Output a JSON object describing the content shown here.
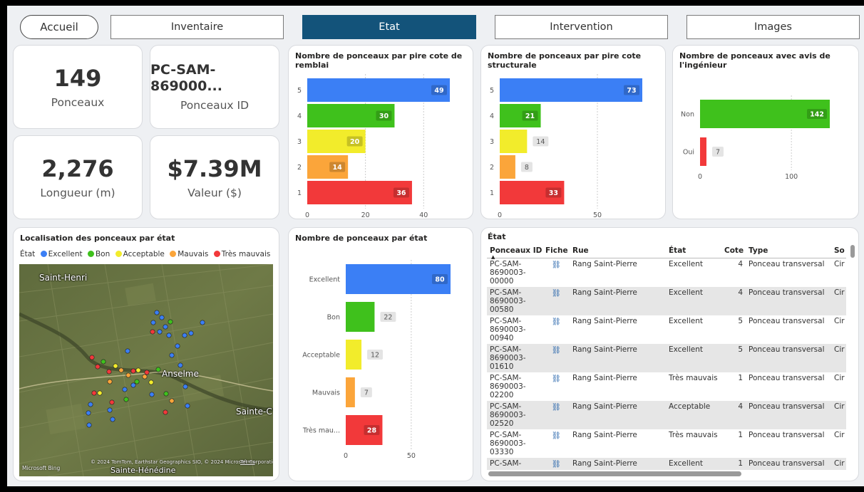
{
  "nav": {
    "home": "Accueil",
    "tabs": [
      "Inventaire",
      "Etat",
      "Intervention",
      "Images"
    ],
    "active_tab": "Etat",
    "active_color": "#13537a"
  },
  "kpis": {
    "count": {
      "value": "149",
      "label": "Ponceaux"
    },
    "id": {
      "value": "PC-SAM-869000...",
      "label": "Ponceaux ID"
    },
    "length": {
      "value": "2,276",
      "label": "Longueur (m)"
    },
    "value": {
      "value": "$7.39M",
      "label": "Valeur ($)"
    }
  },
  "colors": {
    "blue": "#3b7ff5",
    "green": "#3fc11c",
    "yellow": "#f2ec2b",
    "orange": "#fba53a",
    "red": "#f2393a",
    "nav_active": "#13537a"
  },
  "chart_data": [
    {
      "type": "bar",
      "title": "Nombre de ponceaux par pire cote de remblai",
      "categories": [
        "5",
        "4",
        "3",
        "2",
        "1"
      ],
      "values": [
        49,
        30,
        20,
        14,
        36
      ],
      "colors": [
        "#3b7ff5",
        "#3fc11c",
        "#f2ec2b",
        "#fba53a",
        "#f2393a"
      ],
      "xticks": [
        0,
        20,
        40
      ],
      "xlim": [
        0,
        49
      ],
      "grid": "vertical"
    },
    {
      "type": "bar",
      "title": "Nombre de ponceaux par pire cote structurale",
      "categories": [
        "5",
        "4",
        "3",
        "2",
        "1"
      ],
      "values": [
        73,
        21,
        14,
        8,
        33
      ],
      "colors": [
        "#3b7ff5",
        "#3fc11c",
        "#f2ec2b",
        "#fba53a",
        "#f2393a"
      ],
      "xticks": [
        0,
        50
      ],
      "xlim": [
        0,
        73
      ],
      "grid": "vertical"
    },
    {
      "type": "bar",
      "title": "Nombre de ponceaux avec avis de l'ingénieur",
      "categories": [
        "Non",
        "Oui"
      ],
      "values": [
        142,
        7
      ],
      "colors": [
        "#3fc11c",
        "#f2393a"
      ],
      "xticks": [
        0,
        100
      ],
      "xlim": [
        0,
        142
      ],
      "grid": "vertical"
    },
    {
      "type": "bar",
      "title": "Nombre de ponceaux par état",
      "categories": [
        "Excellent",
        "Bon",
        "Acceptable",
        "Mauvais",
        "Très mau..."
      ],
      "values": [
        80,
        22,
        12,
        7,
        28
      ],
      "colors": [
        "#3b7ff5",
        "#3fc11c",
        "#f2ec2b",
        "#fba53a",
        "#f2393a"
      ],
      "xticks": [
        0,
        50
      ],
      "xlim": [
        0,
        80
      ],
      "grid": "vertical"
    }
  ],
  "map": {
    "title": "Localisation des ponceaux par état",
    "legend_title": "État",
    "legend": [
      {
        "label": "Excellent",
        "color": "#3b7ff5"
      },
      {
        "label": "Bon",
        "color": "#3fc11c"
      },
      {
        "label": "Acceptable",
        "color": "#f2ec2b"
      },
      {
        "label": "Mauvais",
        "color": "#fba53a"
      },
      {
        "label": "Très mauvais",
        "color": "#f2393a"
      }
    ],
    "places": {
      "saint_henri": "Saint-Henri",
      "anselme": "Anselme",
      "sainte_c": "Sainte-C",
      "sainte_henedine": "Sainte-Hénédine"
    },
    "bing": "Microsoft Bing",
    "copyright": "© 2024 TomTom, Earthstar Geographics SIO, © 2024 Microsoft Corporation",
    "terms": "Terms"
  },
  "table": {
    "title": "État",
    "columns": [
      "Ponceaux ID",
      "Fiche",
      "Rue",
      "État",
      "Cote",
      "Type",
      "So"
    ],
    "rows": [
      {
        "id": "PC-SAM-8690003-00000",
        "fiche": "⛓",
        "rue": "Rang Saint-Pierre",
        "etat": "Excellent",
        "cote": "4",
        "type": "Ponceau transversal",
        "so": "Cir"
      },
      {
        "id": "PC-SAM-8690003-00580",
        "fiche": "⛓",
        "rue": "Rang Saint-Pierre",
        "etat": "Excellent",
        "cote": "4",
        "type": "Ponceau transversal",
        "so": "Cir"
      },
      {
        "id": "PC-SAM-8690003-00940",
        "fiche": "⛓",
        "rue": "Rang Saint-Pierre",
        "etat": "Excellent",
        "cote": "5",
        "type": "Ponceau transversal",
        "so": "Cir"
      },
      {
        "id": "PC-SAM-8690003-01610",
        "fiche": "⛓",
        "rue": "Rang Saint-Pierre",
        "etat": "Excellent",
        "cote": "5",
        "type": "Ponceau transversal",
        "so": "Cir"
      },
      {
        "id": "PC-SAM-8690003-02200",
        "fiche": "⛓",
        "rue": "Rang Saint-Pierre",
        "etat": "Très mauvais",
        "cote": "1",
        "type": "Ponceau transversal",
        "so": "Cir"
      },
      {
        "id": "PC-SAM-8690003-02520",
        "fiche": "⛓",
        "rue": "Rang Saint-Pierre",
        "etat": "Acceptable",
        "cote": "4",
        "type": "Ponceau transversal",
        "so": "Cir"
      },
      {
        "id": "PC-SAM-8690003-03330",
        "fiche": "⛓",
        "rue": "Rang Saint-Pierre",
        "etat": "Très mauvais",
        "cote": "1",
        "type": "Ponceau transversal",
        "so": "Cir"
      },
      {
        "id": "PC-SAM-",
        "fiche": "⛓",
        "rue": "Rang Saint-Pierre",
        "etat": "Excellent",
        "cote": "1",
        "type": "Ponceau transversal",
        "so": "Cir"
      }
    ]
  }
}
